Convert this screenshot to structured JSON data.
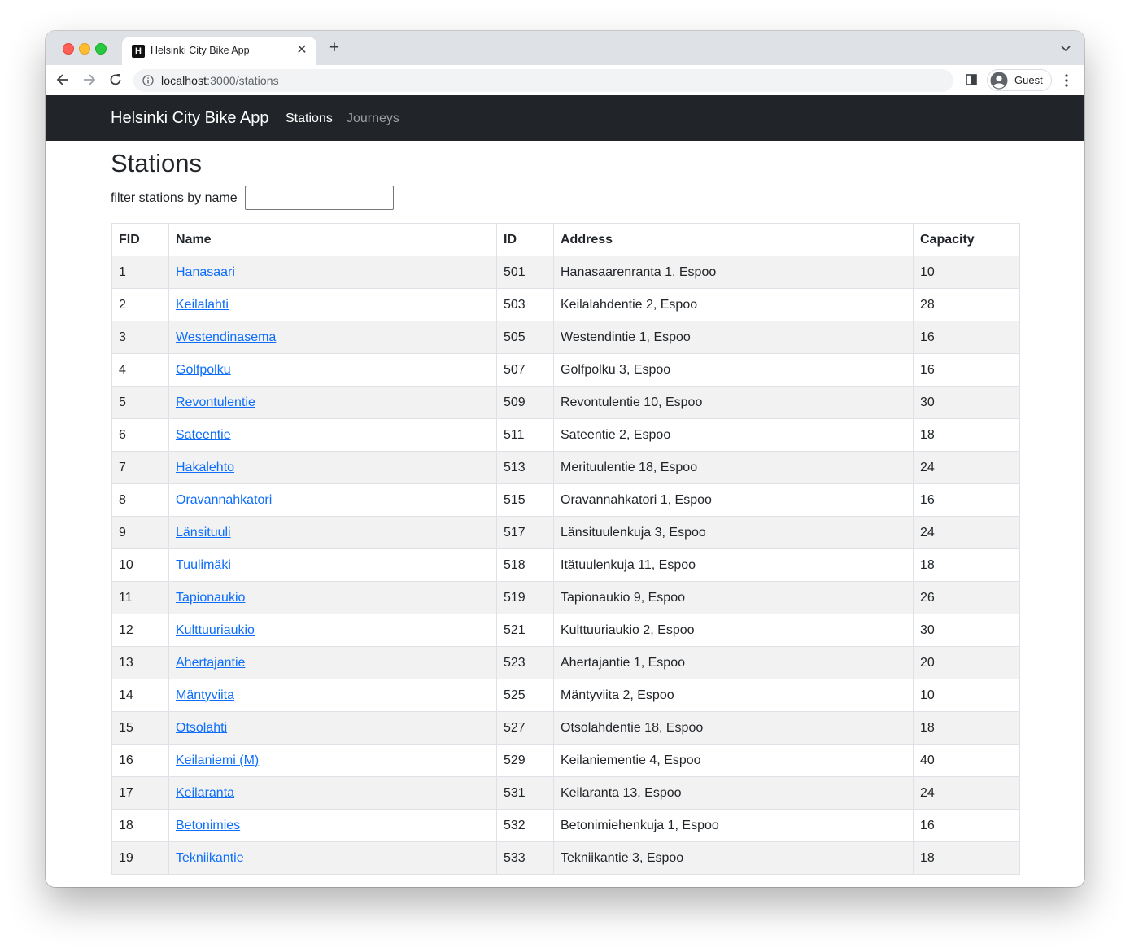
{
  "browser": {
    "tab_title": "Helsinki City Bike App",
    "favicon_letter": "H",
    "url_host": "localhost",
    "url_rest": ":3000/stations",
    "profile_label": "Guest"
  },
  "navbar": {
    "brand": "Helsinki City Bike App",
    "links": [
      "Stations",
      "Journeys"
    ],
    "active_link": "Stations"
  },
  "page": {
    "title": "Stations",
    "filter_label": "filter stations by name",
    "filter_value": ""
  },
  "table": {
    "columns": [
      "FID",
      "Name",
      "ID",
      "Address",
      "Capacity"
    ],
    "rows": [
      {
        "fid": "1",
        "name": "Hanasaari",
        "id": "501",
        "address": "Hanasaarenranta 1, Espoo",
        "capacity": "10"
      },
      {
        "fid": "2",
        "name": "Keilalahti",
        "id": "503",
        "address": "Keilalahdentie 2, Espoo",
        "capacity": "28"
      },
      {
        "fid": "3",
        "name": "Westendinasema",
        "id": "505",
        "address": "Westendintie 1, Espoo",
        "capacity": "16"
      },
      {
        "fid": "4",
        "name": "Golfpolku",
        "id": "507",
        "address": "Golfpolku 3, Espoo",
        "capacity": "16"
      },
      {
        "fid": "5",
        "name": "Revontulentie",
        "id": "509",
        "address": "Revontulentie 10, Espoo",
        "capacity": "30"
      },
      {
        "fid": "6",
        "name": "Sateentie",
        "id": "511",
        "address": "Sateentie 2, Espoo",
        "capacity": "18"
      },
      {
        "fid": "7",
        "name": "Hakalehto",
        "id": "513",
        "address": "Merituulentie 18, Espoo",
        "capacity": "24"
      },
      {
        "fid": "8",
        "name": "Oravannahkatori",
        "id": "515",
        "address": "Oravannahkatori 1, Espoo",
        "capacity": "16"
      },
      {
        "fid": "9",
        "name": "Länsituuli",
        "id": "517",
        "address": "Länsituulenkuja 3, Espoo",
        "capacity": "24"
      },
      {
        "fid": "10",
        "name": "Tuulimäki",
        "id": "518",
        "address": "Itätuulenkuja 11, Espoo",
        "capacity": "18"
      },
      {
        "fid": "11",
        "name": "Tapionaukio",
        "id": "519",
        "address": "Tapionaukio 9, Espoo",
        "capacity": "26"
      },
      {
        "fid": "12",
        "name": "Kulttuuriaukio",
        "id": "521",
        "address": "Kulttuuriaukio 2, Espoo",
        "capacity": "30"
      },
      {
        "fid": "13",
        "name": "Ahertajantie",
        "id": "523",
        "address": "Ahertajantie 1, Espoo",
        "capacity": "20"
      },
      {
        "fid": "14",
        "name": "Mäntyviita",
        "id": "525",
        "address": "Mäntyviita 2, Espoo",
        "capacity": "10"
      },
      {
        "fid": "15",
        "name": "Otsolahti",
        "id": "527",
        "address": "Otsolahdentie 18, Espoo",
        "capacity": "18"
      },
      {
        "fid": "16",
        "name": "Keilaniemi (M)",
        "id": "529",
        "address": "Keilaniementie 4, Espoo",
        "capacity": "40"
      },
      {
        "fid": "17",
        "name": "Keilaranta",
        "id": "531",
        "address": "Keilaranta 13, Espoo",
        "capacity": "24"
      },
      {
        "fid": "18",
        "name": "Betonimies",
        "id": "532",
        "address": "Betonimiehenkuja 1, Espoo",
        "capacity": "16"
      },
      {
        "fid": "19",
        "name": "Tekniikantie",
        "id": "533",
        "address": "Tekniikantie 3, Espoo",
        "capacity": "18"
      }
    ]
  },
  "colors": {
    "navbar_bg": "#212529",
    "link": "#0d6efd",
    "stripe": "#f2f2f2",
    "border": "#dee2e6"
  }
}
